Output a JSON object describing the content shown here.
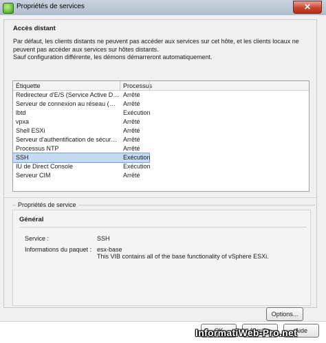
{
  "window": {
    "title": "Propriétés de services",
    "close_glyph": "✕"
  },
  "remote_access": {
    "heading": "Accès distant",
    "description": "Par défaut, les clients distants ne peuvent pas accéder aux services sur cet hôte, et les clients locaux ne peuvent pas accéder aux services sur hôtes distants.",
    "note": "Sauf configuration différente, les démons démarreront automatiquement."
  },
  "services_table": {
    "columns": [
      "Étiquette",
      "Processus"
    ],
    "rows": [
      {
        "label": "Redirecteur d'E/S (Service Active D…",
        "status": "Arrêté"
      },
      {
        "label": "Serveur de connexion au réseau (…",
        "status": "Arrêté"
      },
      {
        "label": "lbtd",
        "status": "Exécution"
      },
      {
        "label": "vpxa",
        "status": "Arrêté"
      },
      {
        "label": "Shell ESXi",
        "status": "Arrêté"
      },
      {
        "label": "Serveur d'authentification de sécur…",
        "status": "Arrêté"
      },
      {
        "label": "Processus NTP",
        "status": "Arrêté"
      },
      {
        "label": "SSH",
        "status": "Exécution"
      },
      {
        "label": "IU de Direct Console",
        "status": "Exécution"
      },
      {
        "label": "Serveur CIM",
        "status": "Arrêté"
      }
    ],
    "selected_row": "SSH"
  },
  "service_properties": {
    "legend": "Propriétés de service",
    "general_heading": "Général",
    "service_label": "Service :",
    "service_value": "SSH",
    "package_label": "Informations du paquet :",
    "package_name": "esx-base",
    "package_description": "This VIB contains all of the base functionality of vSphere ESXi.",
    "options_button": "Options..."
  },
  "footer": {
    "ok": "OK",
    "cancel": "Annuler",
    "help": "Aide"
  },
  "watermark": "InformatiWeb-Pro.net",
  "colors": {
    "selection": "#c5daf3",
    "dialog_bg": "#f0f0f0",
    "close_button": "#c9462e"
  }
}
